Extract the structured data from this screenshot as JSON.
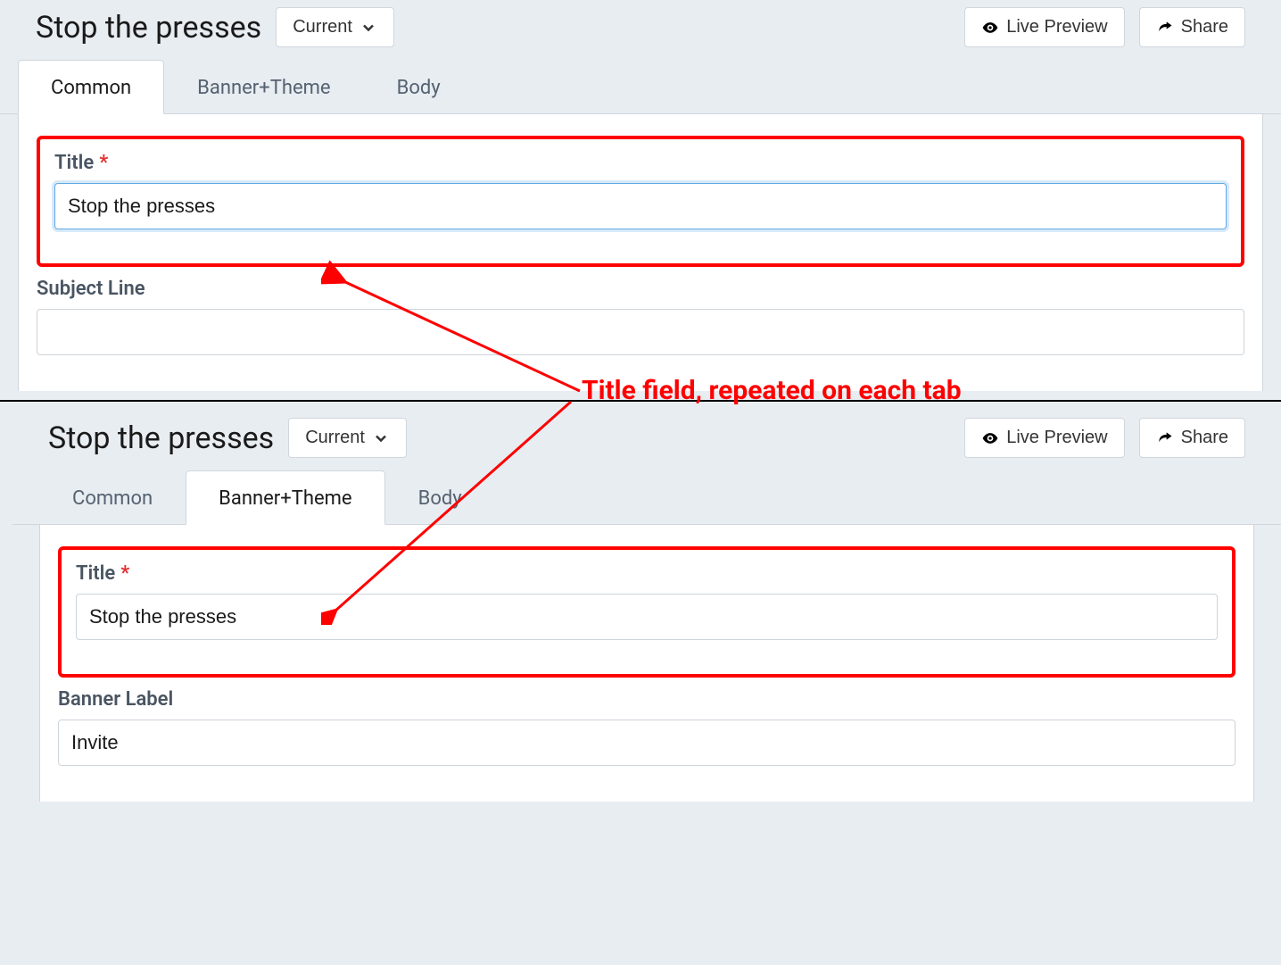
{
  "annotation": {
    "text": "Title field, repeated on each tab"
  },
  "panels": [
    {
      "pageTitle": "Stop the presses",
      "versionLabel": "Current",
      "livePreviewLabel": "Live Preview",
      "shareLabel": "Share",
      "tabs": [
        {
          "label": "Common",
          "active": true
        },
        {
          "label": "Banner+Theme",
          "active": false
        },
        {
          "label": "Body",
          "active": false
        }
      ],
      "fields": {
        "titleLabel": "Title",
        "titleValue": "Stop the presses",
        "subjectLabel": "Subject Line",
        "subjectValue": ""
      }
    },
    {
      "pageTitle": "Stop the presses",
      "versionLabel": "Current",
      "livePreviewLabel": "Live Preview",
      "shareLabel": "Share",
      "tabs": [
        {
          "label": "Common",
          "active": false
        },
        {
          "label": "Banner+Theme",
          "active": true
        },
        {
          "label": "Body",
          "active": false
        }
      ],
      "fields": {
        "titleLabel": "Title",
        "titleValue": "Stop the presses",
        "bannerLabel": "Banner Label",
        "bannerValue": "Invite"
      }
    }
  ]
}
